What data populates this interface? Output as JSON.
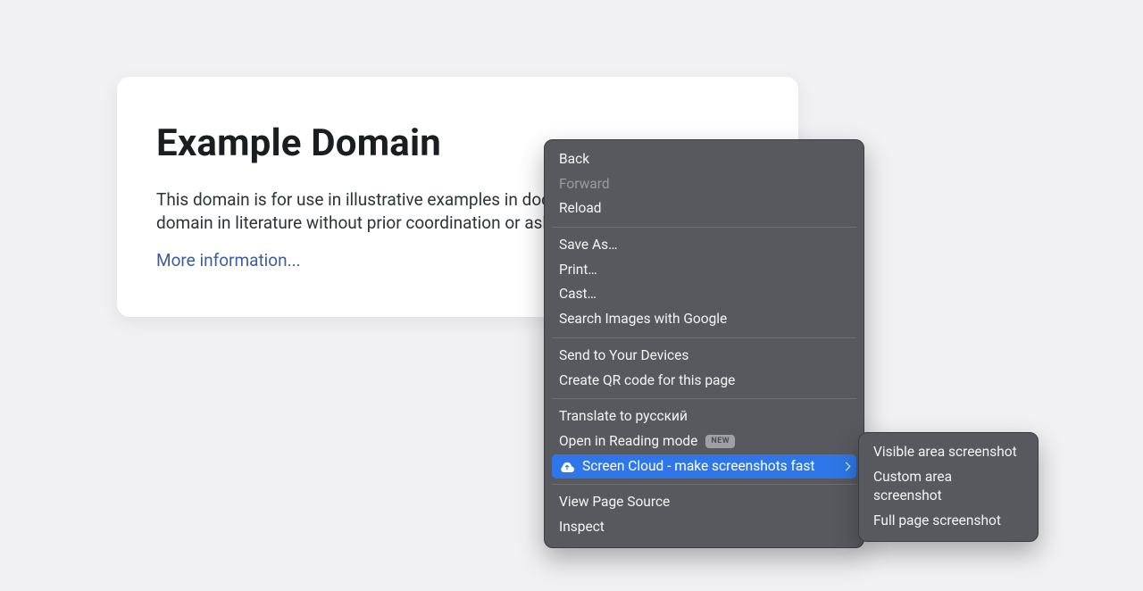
{
  "page": {
    "title": "Example Domain",
    "body": "This domain is for use in illustrative examples in documents. You may use this domain in literature without prior coordination or asking for permission.",
    "link_text": "More information..."
  },
  "context_menu": {
    "back": "Back",
    "forward": "Forward",
    "reload": "Reload",
    "save_as": "Save As…",
    "print": "Print…",
    "cast": "Cast…",
    "search_images": "Search Images with Google",
    "send_devices": "Send to Your Devices",
    "create_qr": "Create QR code for this page",
    "translate": "Translate to русский",
    "reading_mode": "Open in Reading mode",
    "reading_mode_badge": "New",
    "screen_cloud": "Screen Cloud - make screenshots fast",
    "view_source": "View Page Source",
    "inspect": "Inspect"
  },
  "submenu": {
    "visible": "Visible area screenshot",
    "custom": "Custom area screenshot",
    "full": "Full page screenshot"
  }
}
